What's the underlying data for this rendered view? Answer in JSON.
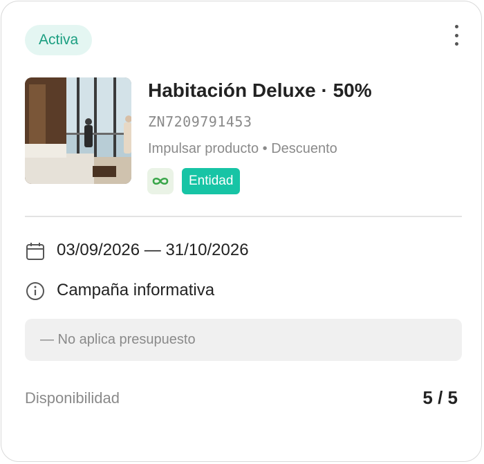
{
  "card": {
    "status_badge": "Activa",
    "title": "Habitación Deluxe · 50%",
    "code": "ZN7209791453",
    "subtitle": "Impulsar producto • Descuento",
    "entity_chip": "Entidad",
    "date_range": "03/09/2026 — 31/10/2026",
    "campaign_type": "Campaña informativa",
    "budget_note": "— No aplica presupuesto",
    "availability_label": "Disponibilidad",
    "availability_value": "5 / 5"
  },
  "icons": {
    "menu": "more-vertical-icon",
    "infinity": "infinity-icon",
    "calendar": "calendar-icon",
    "info": "info-icon"
  },
  "colors": {
    "status_bg": "#e4f6f2",
    "status_text": "#1a9e80",
    "entity_chip": "#17c4a5",
    "infinity_icon": "#3aa64a"
  }
}
